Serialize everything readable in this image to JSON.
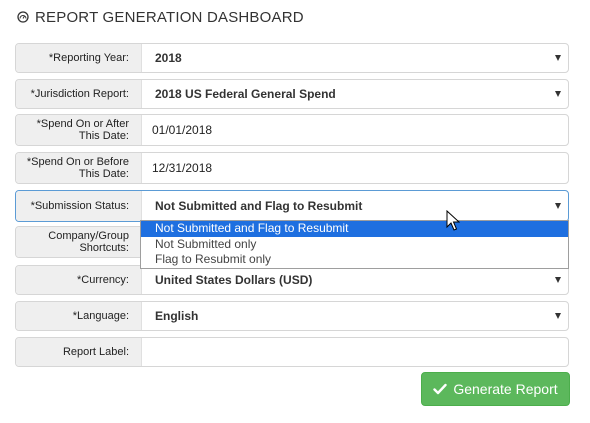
{
  "header": {
    "title": "REPORT GENERATION DASHBOARD",
    "icon": "gauge-icon"
  },
  "form": {
    "reporting_year": {
      "label": "*Reporting Year:",
      "value": "2018"
    },
    "jurisdiction_report": {
      "label": "*Jurisdiction Report:",
      "value": "2018 US Federal General Spend"
    },
    "spend_after": {
      "label_line1": "*Spend On or After",
      "label_line2": "This Date:",
      "value": "01/01/2018"
    },
    "spend_before": {
      "label_line1": "*Spend On or Before",
      "label_line2": "This Date:",
      "value": "12/31/2018"
    },
    "submission_status": {
      "label": "*Submission Status:",
      "value": "Not Submitted and Flag to Resubmit",
      "options": [
        "Not Submitted and Flag to Resubmit",
        "Not Submitted only",
        "Flag to Resubmit only"
      ]
    },
    "company_group": {
      "label_line1": "Company/Group",
      "label_line2": "Shortcuts:"
    },
    "currency": {
      "label": "*Currency:",
      "value": "United States Dollars (USD)"
    },
    "language": {
      "label": "*Language:",
      "value": "English"
    },
    "report_label": {
      "label": "Report Label:",
      "value": ""
    }
  },
  "actions": {
    "generate_label": "Generate Report"
  }
}
